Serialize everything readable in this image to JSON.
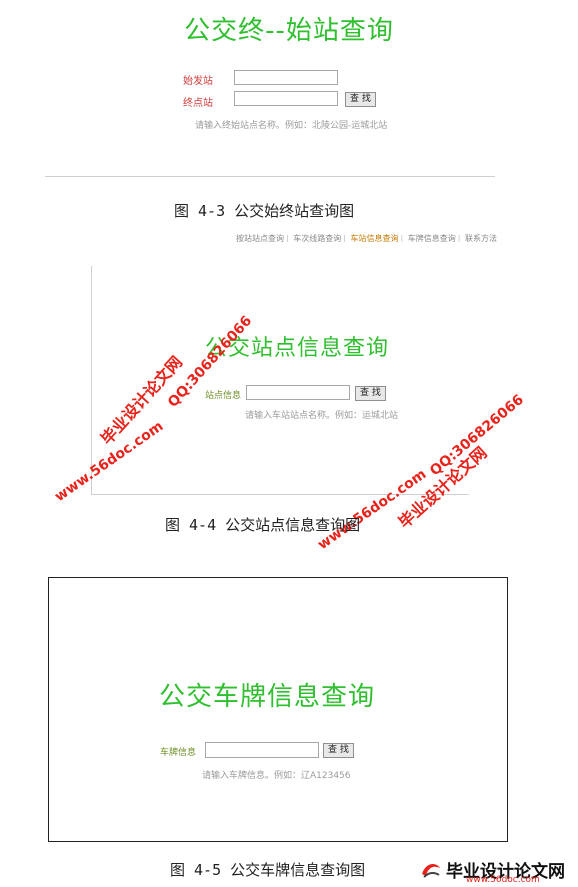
{
  "fig43": {
    "title": "公交终--始站查询",
    "start_label": "始发站",
    "end_label": "终点站",
    "start_value": "",
    "end_value": "",
    "search_button": "查 找",
    "hint": "请输入终始站点名称。例如：北陵公园-运城北站",
    "caption": "图 4-3   公交始终站查询图"
  },
  "fig44": {
    "nav_items": [
      "按站站点查询",
      "车次线路查询",
      "车站信息查询",
      "车牌信息查询",
      "联系方法"
    ],
    "nav_active_index": 2,
    "title": "公交站点信息查询",
    "label": "站点信息",
    "input_value": "",
    "search_button": "查 找",
    "hint": "请输入车站站点名称。例如：运城北站",
    "caption": "图 4-4   公交站点信息查询图"
  },
  "fig45": {
    "title": "公交车牌信息查询",
    "label": "车牌信息",
    "input_value": "",
    "search_button": "查 找",
    "hint": "请输入车牌信息。例如：辽A123456",
    "caption": "图 4-5  公交车牌信息查询图"
  },
  "watermarks": {
    "site_text": "毕业设计论文网",
    "url_text": "www.56doc.com",
    "qq_text": "QQ:306826066"
  },
  "logo": {
    "main": "毕业设计论文网",
    "sub": "www.56doc.com"
  }
}
